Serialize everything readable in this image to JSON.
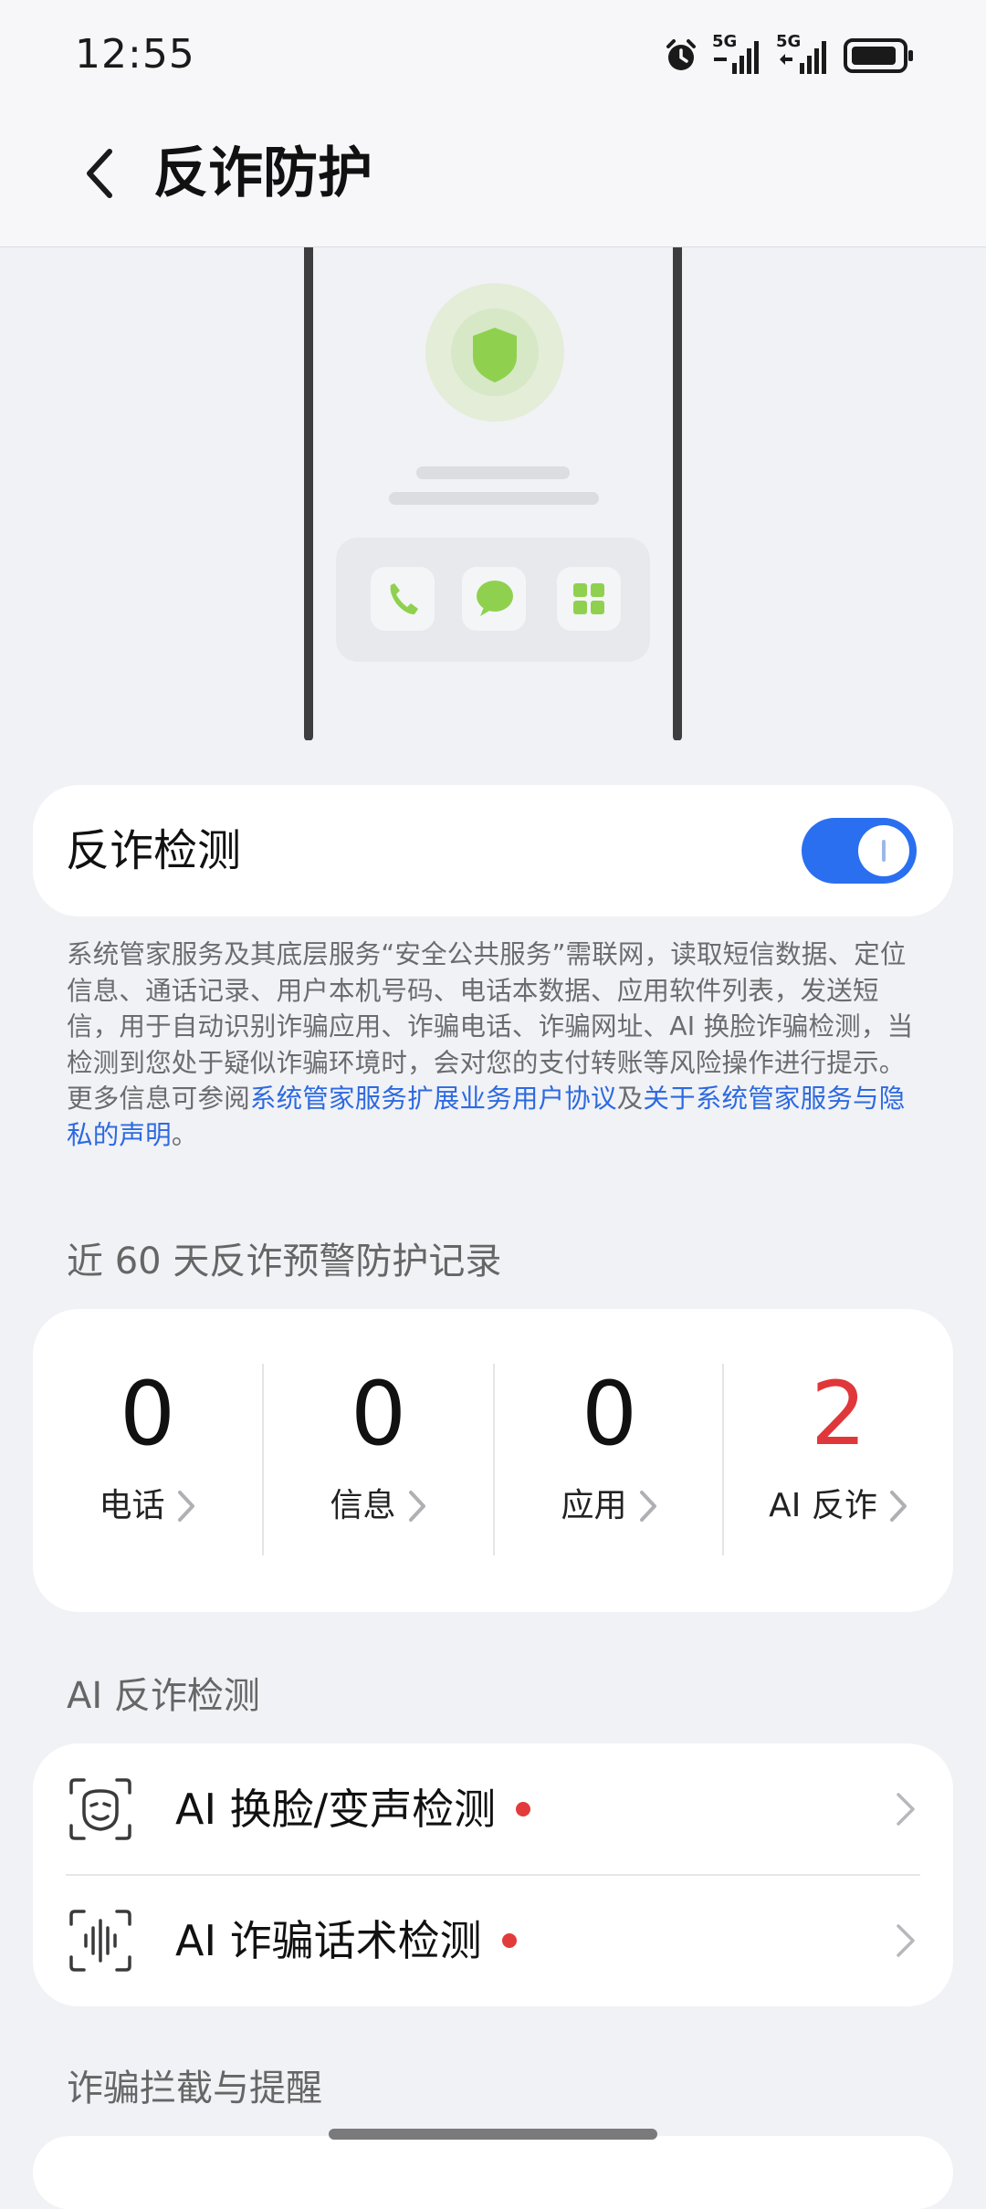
{
  "status_bar": {
    "time": "12:55",
    "signal1_label": "5G",
    "signal2_label": "5G"
  },
  "header": {
    "title": "反诈防护"
  },
  "detection": {
    "label": "反诈检测",
    "enabled": true,
    "accent_color": "#2a6ff0"
  },
  "disclaimer": {
    "text_before": "系统管家服务及其底层服务“安全公共服务”需联网，读取短信数据、定位信息、通话记录、用户本机号码、电话本数据、应用软件列表，发送短信，用于自动识别诈骗应用、诈骗电话、诈骗网址、AI 换脸诈骗检测，当检测到您处于疑似诈骗环境时，会对您的支付转账等风险操作进行提示。更多信息可参阅",
    "link1": "系统管家服务扩展业务用户协议",
    "connector": "及",
    "link2": "关于系统管家服务与隐私的声明",
    "end": "。"
  },
  "records": {
    "section_title": "近 60 天反诈预警防护记录",
    "items": [
      {
        "value": "0",
        "label": "电话"
      },
      {
        "value": "0",
        "label": "信息"
      },
      {
        "value": "0",
        "label": "应用"
      },
      {
        "value": "2",
        "label": "AI 反诈"
      }
    ]
  },
  "ai_section": {
    "title": "AI 反诈检测",
    "items": [
      {
        "label": "AI 换脸/变声检测",
        "icon": "face-scan-icon"
      },
      {
        "label": "AI 诈骗话术检测",
        "icon": "voice-scan-icon"
      }
    ]
  },
  "fraud_section": {
    "title": "诈骗拦截与提醒"
  }
}
